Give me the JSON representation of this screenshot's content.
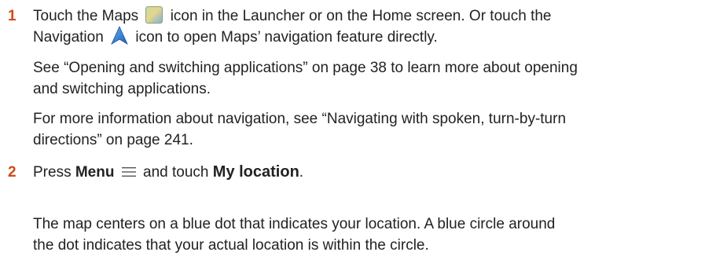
{
  "steps": [
    {
      "number": "1",
      "line1_a": "Touch the Maps",
      "line1_b": "icon in the Launcher or on the Home screen. Or touch the",
      "line2_a": "Navigation",
      "line2_b": "icon to open Maps’ navigation feature directly.",
      "para2_line1": "See “Opening and switching applications” on page 38 to learn more about opening",
      "para2_line2": "and switching applications.",
      "para3_line1": "For more information about navigation, see “Navigating with spoken, turn-by-turn",
      "para3_line2": "directions” on page 241."
    },
    {
      "number": "2",
      "press": "Press",
      "menu_term": "Menu",
      "and_touch": "and touch",
      "location_term": "My location",
      "period": ".",
      "para2_line1": "The map centers on a blue dot that indicates your location. A blue circle around",
      "para2_line2": "the dot indicates that your actual location is within the circle."
    }
  ],
  "icons": {
    "maps": "maps-app-icon",
    "navigation": "navigation-arrow-icon",
    "menu": "menu-icon"
  },
  "colors": {
    "step_number": "#d14a12",
    "text": "#222222",
    "nav_arrow": "#2f7fd6"
  }
}
